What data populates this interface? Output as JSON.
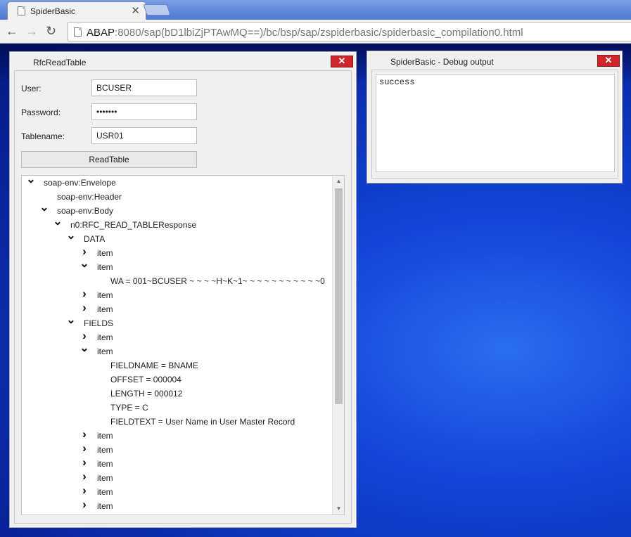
{
  "browser": {
    "tab_title": "SpiderBasic",
    "url_host": "ABAP",
    "url_rest": ":8080/sap(bD1lbiZjPTAwMQ==)/bc/bsp/sap/zspiderbasic/spiderbasic_compilation0.html",
    "close_glyph": "✕",
    "back_glyph": "←",
    "forward_glyph": "→",
    "reload_glyph": "↻"
  },
  "rfc_window": {
    "title": "RfcReadTable",
    "close_glyph": "✕",
    "form": {
      "user_label": "User:",
      "user_value": "BCUSER",
      "password_label": "Password:",
      "password_value": "•••••••",
      "tablename_label": "Tablename:",
      "tablename_value": "USR01",
      "read_button": "ReadTable"
    },
    "tree": [
      {
        "label": "soap-env:Envelope",
        "toggle": "expanded",
        "depth": 0
      },
      {
        "label": "soap-env:Header",
        "toggle": "none",
        "depth": 1
      },
      {
        "label": "soap-env:Body",
        "toggle": "expanded",
        "depth": 1
      },
      {
        "label": "n0:RFC_READ_TABLEResponse",
        "toggle": "expanded",
        "depth": 2
      },
      {
        "label": "DATA",
        "toggle": "expanded",
        "depth": 3
      },
      {
        "label": "item",
        "toggle": "collapsed",
        "depth": 4
      },
      {
        "label": "item",
        "toggle": "expanded",
        "depth": 4
      },
      {
        "label": "WA = 001~BCUSER ~ ~ ~ ~H~K~1~ ~ ~ ~ ~ ~ ~ ~ ~ ~ ~0",
        "toggle": "none",
        "depth": 5
      },
      {
        "label": "item",
        "toggle": "collapsed",
        "depth": 4
      },
      {
        "label": "item",
        "toggle": "collapsed",
        "depth": 4
      },
      {
        "label": "FIELDS",
        "toggle": "expanded",
        "depth": 3
      },
      {
        "label": "item",
        "toggle": "collapsed",
        "depth": 4
      },
      {
        "label": "item",
        "toggle": "expanded",
        "depth": 4
      },
      {
        "label": "FIELDNAME = BNAME",
        "toggle": "none",
        "depth": 5
      },
      {
        "label": "OFFSET = 000004",
        "toggle": "none",
        "depth": 5
      },
      {
        "label": "LENGTH = 000012",
        "toggle": "none",
        "depth": 5
      },
      {
        "label": "TYPE = C",
        "toggle": "none",
        "depth": 5
      },
      {
        "label": "FIELDTEXT = User Name in User Master Record",
        "toggle": "none",
        "depth": 5
      },
      {
        "label": "item",
        "toggle": "collapsed",
        "depth": 4
      },
      {
        "label": "item",
        "toggle": "collapsed",
        "depth": 4
      },
      {
        "label": "item",
        "toggle": "collapsed",
        "depth": 4
      },
      {
        "label": "item",
        "toggle": "collapsed",
        "depth": 4
      },
      {
        "label": "item",
        "toggle": "collapsed",
        "depth": 4
      },
      {
        "label": "item",
        "toggle": "collapsed",
        "depth": 4
      }
    ],
    "scroll_up_glyph": "▲",
    "scroll_down_glyph": "▼"
  },
  "debug_window": {
    "title": "SpiderBasic - Debug output",
    "close_glyph": "✕",
    "output": "success"
  },
  "colors": {
    "close_button": "#d0252a",
    "desktop": "#0a2ec0"
  }
}
